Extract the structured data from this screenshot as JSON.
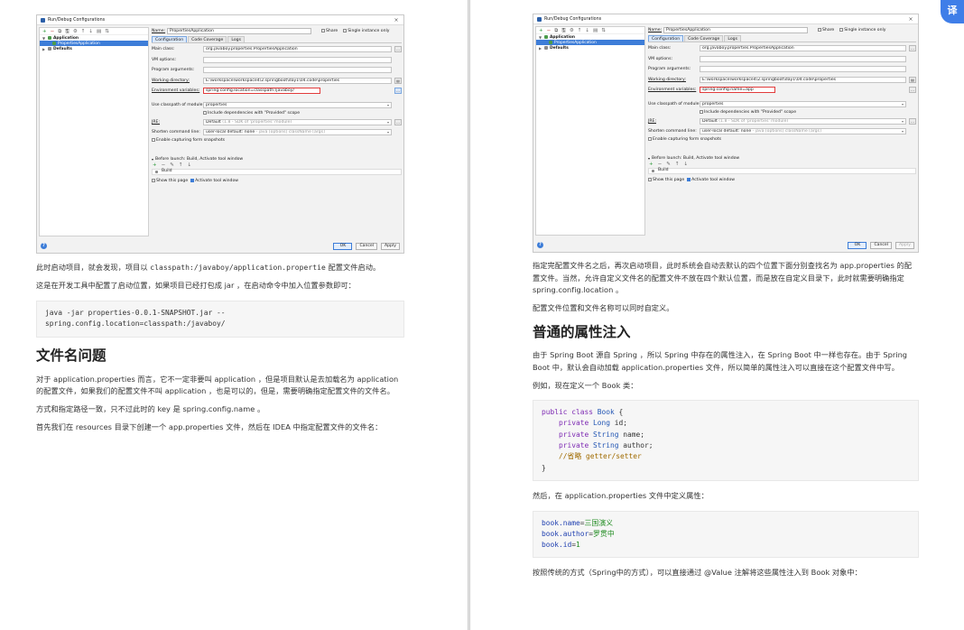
{
  "dialog_left": {
    "title": "Run/Debug Configurations",
    "close": "×",
    "toolbar": [
      "+",
      "−",
      "⧉",
      "🖫",
      "⚙",
      "↑",
      "↓",
      "▤",
      "⇅"
    ],
    "tree": {
      "application": "Application",
      "child": "PropertiesApplication",
      "defaults": "Defaults"
    },
    "name_label": "Name:",
    "name_value": "PropertiesApplication",
    "share_label": "Share",
    "single_instance_label": "Single instance only",
    "tabs": [
      "Configuration",
      "Code Coverage",
      "Logs"
    ],
    "fields": {
      "main_class_label": "Main class:",
      "main_class": "org.javaboy.properties.PropertiesApplication",
      "vm_options_label": "VM options:",
      "vm_options": "",
      "program_args_label": "Program arguments:",
      "program_args": "",
      "working_dir_label": "Working directory:",
      "working_dir": "E:\\workspace\\workspace4\\2.springboot\\day1\\04.code\\properties",
      "env_label": "Environment variables:",
      "env": "spring.config.location=classpath:/javaboy/",
      "classpath_label": "Use classpath of module:",
      "classpath": "properties",
      "include_provided": "Include dependencies with \"Provided\" scope",
      "jre_label": "JRE:",
      "jre": "Default",
      "jre_hint": "(1.8 - SDK of 'properties' module)",
      "shorten_label": "Shorten command line:",
      "shorten": "user-local default: none",
      "shorten_hint": "- java [options] className [args]",
      "enable_snapshots": "Enable capturing form snapshots"
    },
    "before_launch": "Before launch: Build, Activate tool window",
    "build_item": "Build",
    "show_page": "Show this page",
    "activate_tool": "Activate tool window",
    "buttons": {
      "ok": "OK",
      "cancel": "Cancel",
      "apply": "Apply"
    }
  },
  "dialog_right": {
    "title": "Run/Debug Configurations",
    "close": "×",
    "toolbar": [
      "+",
      "−",
      "⧉",
      "🖫",
      "⚙",
      "↑",
      "↓",
      "▤",
      "⇅"
    ],
    "tree": {
      "application": "Application",
      "child": "PropertiesApplication",
      "defaults": "Defaults"
    },
    "name_label": "Name:",
    "name_value": "PropertiesApplication",
    "share_label": "Share",
    "single_instance_label": "Single instance only",
    "tabs": [
      "Configuration",
      "Code Coverage",
      "Logs"
    ],
    "fields": {
      "main_class_label": "Main class:",
      "main_class": "org.javaboy.properties.PropertiesApplication",
      "vm_options_label": "VM options:",
      "vm_options": "",
      "program_args_label": "Program arguments:",
      "program_args": "",
      "working_dir_label": "Working directory:",
      "working_dir": "E:\\workspace\\workspace4\\2.springboot\\day1\\04.code\\properties",
      "env_label": "Environment variables:",
      "env": "spring.config.name=app",
      "classpath_label": "Use classpath of module:",
      "classpath": "properties",
      "include_provided": "Include dependencies with \"Provided\" scope",
      "jre_label": "JRE:",
      "jre": "Default",
      "jre_hint": "(1.8 - SDK of 'properties' module)",
      "shorten_label": "Shorten command line:",
      "shorten": "user-local default: none",
      "shorten_hint": "- java [options] className [args]",
      "enable_snapshots": "Enable capturing form snapshots"
    },
    "before_launch": "Before launch: Build, Activate tool window",
    "build_item": "Build",
    "show_page": "Show this page",
    "activate_tool": "Activate tool window",
    "buttons": {
      "ok": "OK",
      "cancel": "Cancel",
      "apply": "Apply"
    }
  },
  "left_article": {
    "p1_a": "此时启动项目，就会发现，项目以 ",
    "p1_code": "classpath:/javaboy/application.propertie",
    "p1_b": " 配置文件启动。",
    "p2": "这是在开发工具中配置了启动位置，如果项目已经打包成 jar ，在启动命令中加入位置参数即可：",
    "code1_line1": "java -jar properties-0.0.1-SNAPSHOT.jar --",
    "code1_line2": "spring.config.location=classpath:/javaboy/",
    "heading": "文件名问题",
    "p3": "对于 application.properties 而言，它不一定非要叫 application ，但是项目默认是去加载名为 application 的配置文件，如果我们的配置文件不叫 application ，也是可以的，但是，需要明确指定配置文件的文件名。",
    "p4": "方式和指定路径一致，只不过此时的 key 是 spring.config.name 。",
    "p5": "首先我们在 resources 目录下创建一个 app.properties 文件，然后在 IDEA 中指定配置文件的文件名："
  },
  "right_article": {
    "p1": "指定完配置文件名之后，再次启动项目，此时系统会自动去默认的四个位置下面分别查找名为 app.properties 的配置文件。当然，允许自定义文件名的配置文件不放在四个默认位置，而是放在自定义目录下，此时就需要明确指定 spring.config.location 。",
    "p2": "配置文件位置和文件名称可以同时自定义。",
    "heading": "普通的属性注入",
    "p3": "由于 Spring Boot 源自 Spring ，所以 Spring 中存在的属性注入，在 Spring Boot 中一样也存在。由于 Spring Boot 中，默认会自动加载 application.properties 文件，所以简单的属性注入可以直接在这个配置文件中写。",
    "p4": "例如，现在定义一个 Book 类：",
    "code_book": {
      "l1_kw": "public class",
      "l1_name": " Book ",
      "l1_brace": "{",
      "l2_kw": "private",
      "l2_type": " Long",
      "l2_name": " id;",
      "l3_kw": "private",
      "l3_type": " String",
      "l3_name": " name;",
      "l4_kw": "private",
      "l4_type": " String",
      "l4_name": " author;",
      "l5_comment": "//省略 getter/setter",
      "l6": "}"
    },
    "p5": "然后，在 application.properties 文件中定义属性：",
    "props": [
      {
        "key": "book.name",
        "eq": "=",
        "value": "三国演义"
      },
      {
        "key": "book.author",
        "eq": "=",
        "value": "罗贯中"
      },
      {
        "key": "book.id",
        "eq": "=",
        "value": "1"
      }
    ],
    "p6": "按照传统的方式（Spring中的方式），可以直接通过 @Value 注解将这些属性注入到 Book 对象中："
  },
  "fab_label": "译"
}
